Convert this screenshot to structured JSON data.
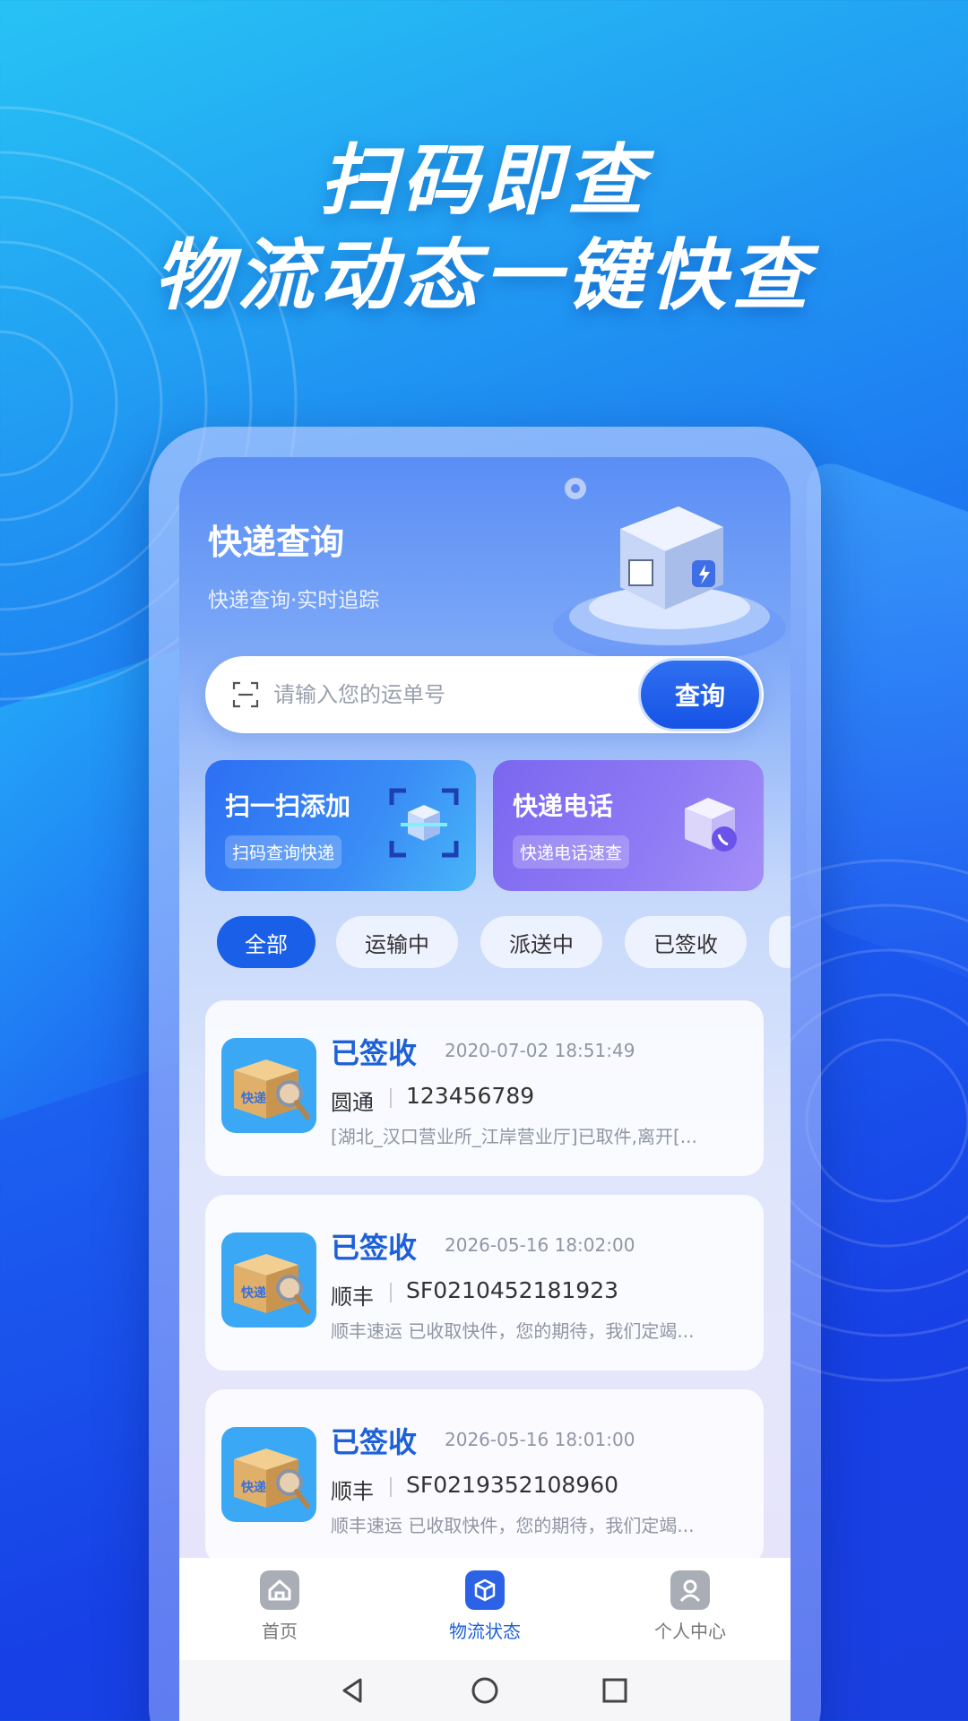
{
  "promo": {
    "line1": "扫码即查",
    "line2": "物流动态一键快查"
  },
  "app": {
    "title": "快递查询",
    "subtitle": "快递查询·实时追踪"
  },
  "search": {
    "placeholder": "请输入您的运单号",
    "button_label": "查询"
  },
  "quick_actions": [
    {
      "title": "扫一扫添加",
      "tag": "扫码查询快递"
    },
    {
      "title": "快递电话",
      "tag": "快递电话速查"
    }
  ],
  "filter_tabs": [
    {
      "label": "全部",
      "active": true
    },
    {
      "label": "运输中",
      "active": false
    },
    {
      "label": "派送中",
      "active": false
    },
    {
      "label": "已签收",
      "active": false
    }
  ],
  "shipments": [
    {
      "status": "已签收",
      "time": "2020-07-02 18:51:49",
      "carrier": "圆通",
      "tracking_no": "123456789",
      "description": "[湖北_汉口营业所_江岸营业厅]已取件,离开[..."
    },
    {
      "status": "已签收",
      "time": "2026-05-16 18:02:00",
      "carrier": "顺丰",
      "tracking_no": "SF0210452181923",
      "description": "顺丰速运 已收取快件，您的期待，我们定竭..."
    },
    {
      "status": "已签收",
      "time": "2026-05-16 18:01:00",
      "carrier": "顺丰",
      "tracking_no": "SF0219352108960",
      "description": "顺丰速运 已收取快件，您的期待，我们定竭..."
    }
  ],
  "bottom_nav": [
    {
      "label": "首页",
      "icon": "home-icon",
      "active": false
    },
    {
      "label": "物流状态",
      "icon": "package-icon",
      "active": true
    },
    {
      "label": "个人中心",
      "icon": "user-icon",
      "active": false
    }
  ],
  "thumb_label": "快递",
  "colors": {
    "accent": "#1a5fe8",
    "status_text": "#1d60d8"
  }
}
